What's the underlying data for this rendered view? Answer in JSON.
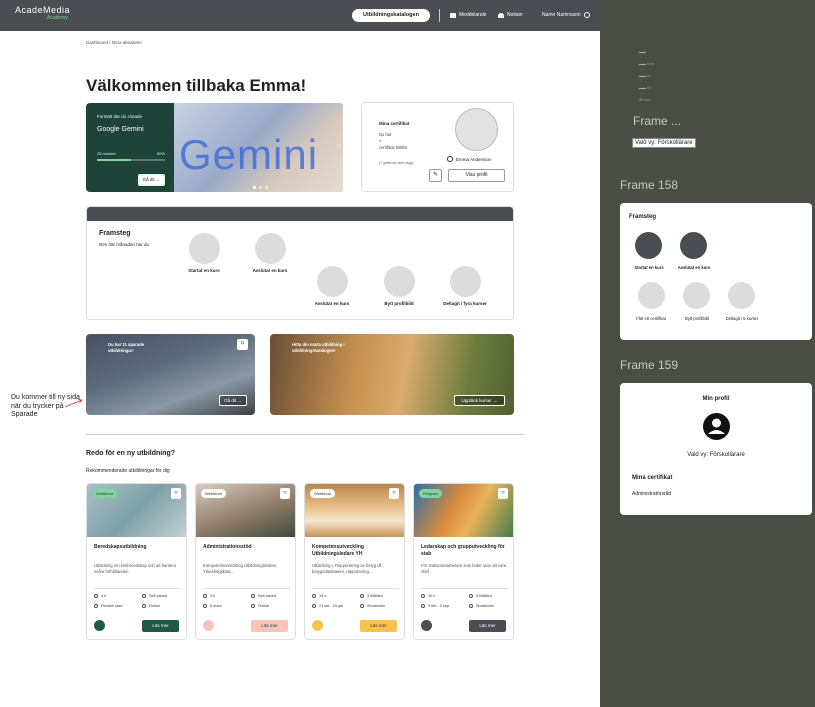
{
  "header": {
    "logo_main": "AcadeMedia",
    "logo_sub": "Academy",
    "catalog_button": "Utbildningskatalogen",
    "nav_messages": "Meddelande",
    "nav_notices": "Notiser",
    "nav_user": "Namn Namnsson"
  },
  "breadcrumb": "Dashboard / Mina aktiviteter",
  "welcome": "Välkommen tillbaka Emma!",
  "hero": {
    "eyebrow": "Fortsätt där du slutade",
    "course": "Google Gemini",
    "duration": "25 minuter",
    "progress_label": "50%",
    "progress": 0.5,
    "go_button": "Gå dit →",
    "brand_text": "Gemini"
  },
  "certificates_card": {
    "title": "Mina certifikat",
    "line1": "Du har",
    "count": "7",
    "line2": "certifikat hittills!",
    "note": "(+ gäller/ex-dom-tagg)",
    "name": "Emma Andersson",
    "view_profile": "Visa profil"
  },
  "progress_section": {
    "title": "Framsteg",
    "subtitle": "Den här månaden har du",
    "items": [
      "Startat en kurs",
      "Avslutat en kurs",
      "Avslutat en kurs",
      "Bytt profilbild",
      "Deltagit i fyra kurser"
    ]
  },
  "promos": [
    {
      "text": "Du har 11 sparade utbildningar!",
      "button": "Gå dit →"
    },
    {
      "text": "Hitta din nästa utbildning i utbildningskatalogen!",
      "button": "Upptäck kurser →"
    }
  ],
  "annotation": "Du kommer till ny sida när du trycker på Sparade",
  "recommend": {
    "title": "Redo för en ny utbildning?",
    "subtitle": "Rekommenderade utbildningar för dig"
  },
  "courses": [
    {
      "tag": "Webbinar",
      "title": "Beredskapsutbildning",
      "desc": "Utbildning om krisberedskap och att hantera svåra förhållanden",
      "m1": "4 h",
      "m2": "Self paced",
      "m3": "Flexibel start",
      "m4": "Online",
      "button": "Läs mer",
      "color": "#1f5a44",
      "btn_text": "#fff",
      "icon_color": "#1f5a44"
    },
    {
      "tag": "Webbinar",
      "title": "Administrationsstöd",
      "desc": "Kompetensutveckling Utbildningsledare Yrkeshögskola...",
      "m1": "4 h",
      "m2": "Self paced",
      "m3": "6 mars",
      "m4": "Online",
      "button": "Läs mer",
      "color": "#f5c6b8",
      "btn_text": "#333",
      "icon_color": "#f5c6b8"
    },
    {
      "tag": "Webbinar",
      "title": "Kompetensutveckling Utbildningsledare YH",
      "desc": "Utbildning i, Rapportering av betyg till betygsdatabasen, rapportering...",
      "m1": "15 h",
      "m2": "3 tillfällen",
      "m3": "21 okt - 15 jan",
      "m4": "Stockholm",
      "button": "Läs mer",
      "color": "#f7c24d",
      "btn_text": "#333",
      "icon_color": "#f7c24d"
    },
    {
      "tag": "Program",
      "title": "Ledarskap och grupputveckling för stab",
      "desc": "För stabsmedarbetare som leder utan att vara chef",
      "m1": "10 h",
      "m2": "6 tillfällen",
      "m3": "9 feb - 3 sep",
      "m4": "Stockholm",
      "button": "Läs mer",
      "color": "#4a4d52",
      "btn_text": "#fff",
      "icon_color": "#4a4d52"
    }
  ],
  "side": {
    "frame_a": "Frame ...",
    "valid_a": "Vald vy: Förskollärare",
    "frame_158": "Frame 158",
    "p158_title": "Framsteg",
    "p158_items": [
      "Startat en kurs",
      "Avslutat en kurs",
      "Fått ett certifikat",
      "Bytt profilbild",
      "Deltagit i 5 kurser"
    ],
    "frame_159": "Frame 159",
    "p159_title": "Min profil",
    "p159_valid": "Vald vy: Förskollärare",
    "p159_cert": "Mina certifikat",
    "p159_cert_item": "Administratörsråd"
  }
}
